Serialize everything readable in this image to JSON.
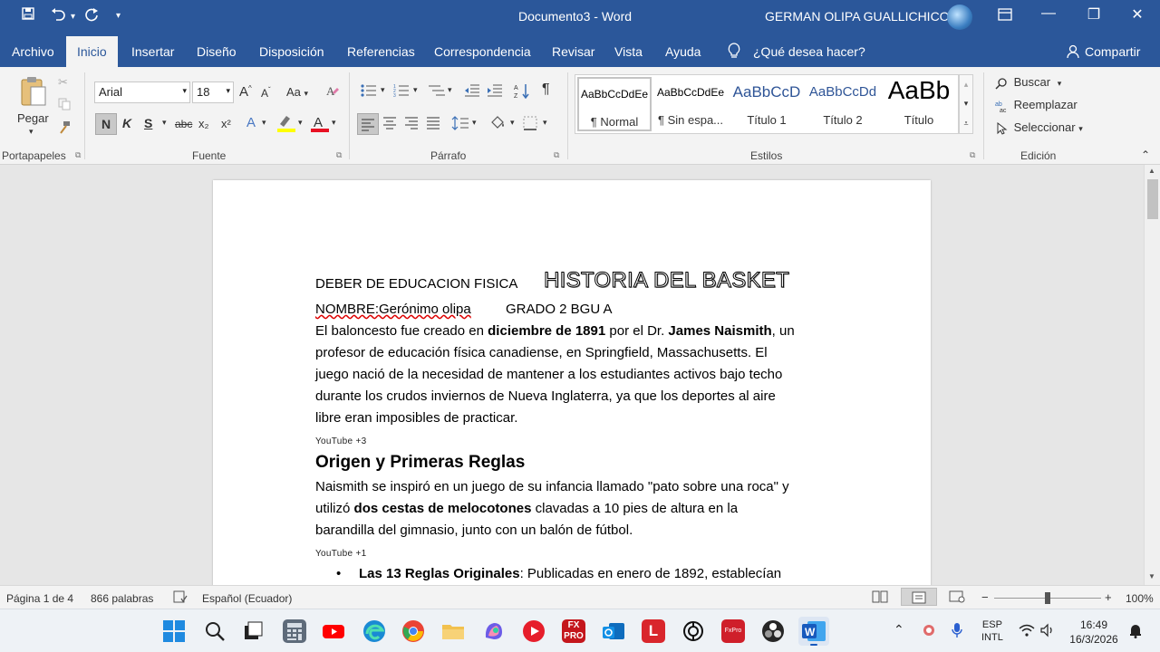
{
  "titlebar": {
    "doc_title": "Documento3 - Word",
    "user": "GERMAN OLIPA GUALLICHICO",
    "save_icon": "save-icon",
    "undo_icon": "undo-icon",
    "redo_icon": "redo-icon",
    "customize_icon": "chevron-down-icon",
    "ribbon_display_icon": "ribbon-display-icon",
    "minimize_glyph": "—",
    "maximize_glyph": "❐",
    "close_glyph": "✕"
  },
  "tabs": {
    "archivo": "Archivo",
    "inicio": "Inicio",
    "insertar": "Insertar",
    "diseno": "Diseño",
    "disposicion": "Disposición",
    "referencias": "Referencias",
    "correspondencia": "Correspondencia",
    "revisar": "Revisar",
    "vista": "Vista",
    "ayuda": "Ayuda",
    "tell_me": "¿Qué desea hacer?",
    "share": "Compartir"
  },
  "ribbon": {
    "clipboard": {
      "label": "Portapapeles",
      "paste": "Pegar"
    },
    "font": {
      "label": "Fuente",
      "family": "Arial",
      "size": "18",
      "bold": "N",
      "italic": "K",
      "underline": "S",
      "strike": "abc",
      "subscript": "x₂",
      "superscript": "x²",
      "grow": "A",
      "shrink": "A",
      "change_case": "Aa",
      "font_color": "A",
      "highlight_color": "#ffff00",
      "text_color": "#e81123"
    },
    "paragraph": {
      "label": "Párrafo",
      "show_marks": "¶"
    },
    "styles": {
      "label": "Estilos",
      "items": [
        {
          "sample": "AaBbCcDdEe",
          "name": "¶ Normal"
        },
        {
          "sample": "AaBbCcDdEe",
          "name": "¶ Sin espa..."
        },
        {
          "sample": "AaBbCcD",
          "name": "Título 1"
        },
        {
          "sample": "AaBbCcDd",
          "name": "Título 2"
        },
        {
          "sample": "AaBb",
          "name": "Título"
        }
      ]
    },
    "editing": {
      "label": "Edición",
      "find": "Buscar",
      "replace": "Reemplazar",
      "select": "Seleccionar"
    }
  },
  "document": {
    "header_left": "DEBER DE EDUCACION FISICA",
    "header_title": "HISTORIA DEL BASKET",
    "name_line": "NOMBRE:Gerónimo olipa",
    "grade": "GRADO 2 BGU A",
    "p1": {
      "l1a": "El baloncesto fue creado en ",
      "l1b": "diciembre de 1891",
      "l1c": " por el Dr. ",
      "l1d": "James Naismith",
      "l1e": ", un",
      "l2": "profesor de educación física canadiense, en Springfield, Massachusetts. El",
      "l3": "juego nació de la necesidad de mantener a los estudiantes activos bajo techo",
      "l4": "durante los crudos inviernos de Nueva Inglaterra, ya que los deportes al aire",
      "l5": "libre eran imposibles de practicar."
    },
    "source1": "YouTube +3",
    "heading": "Origen y Primeras Reglas",
    "p2": {
      "l1": "Naismith se inspiró en un juego de su infancia llamado \"pato sobre una roca\" y",
      "l2a": "utilizó ",
      "l2b": "dos cestas de melocotones",
      "l2c": " clavadas a 10 pies de altura en la",
      "l3": "barandilla del gimnasio, junto con un balón de fútbol."
    },
    "source2": "YouTube +1",
    "bullet": {
      "marker": "•",
      "bold": "Las 13 Reglas Originales",
      "rest": ": Publicadas en enero de 1892, establecían"
    }
  },
  "status": {
    "page": "Página 1 de 4",
    "words": "866 palabras",
    "language": "Español (Ecuador)",
    "zoom": "100%",
    "zoom_minus": "−",
    "zoom_plus": "+"
  },
  "taskbar": {
    "lang_top": "ESP",
    "lang_bottom": "INTL",
    "time": "16:49",
    "date": "16/3/2026"
  }
}
